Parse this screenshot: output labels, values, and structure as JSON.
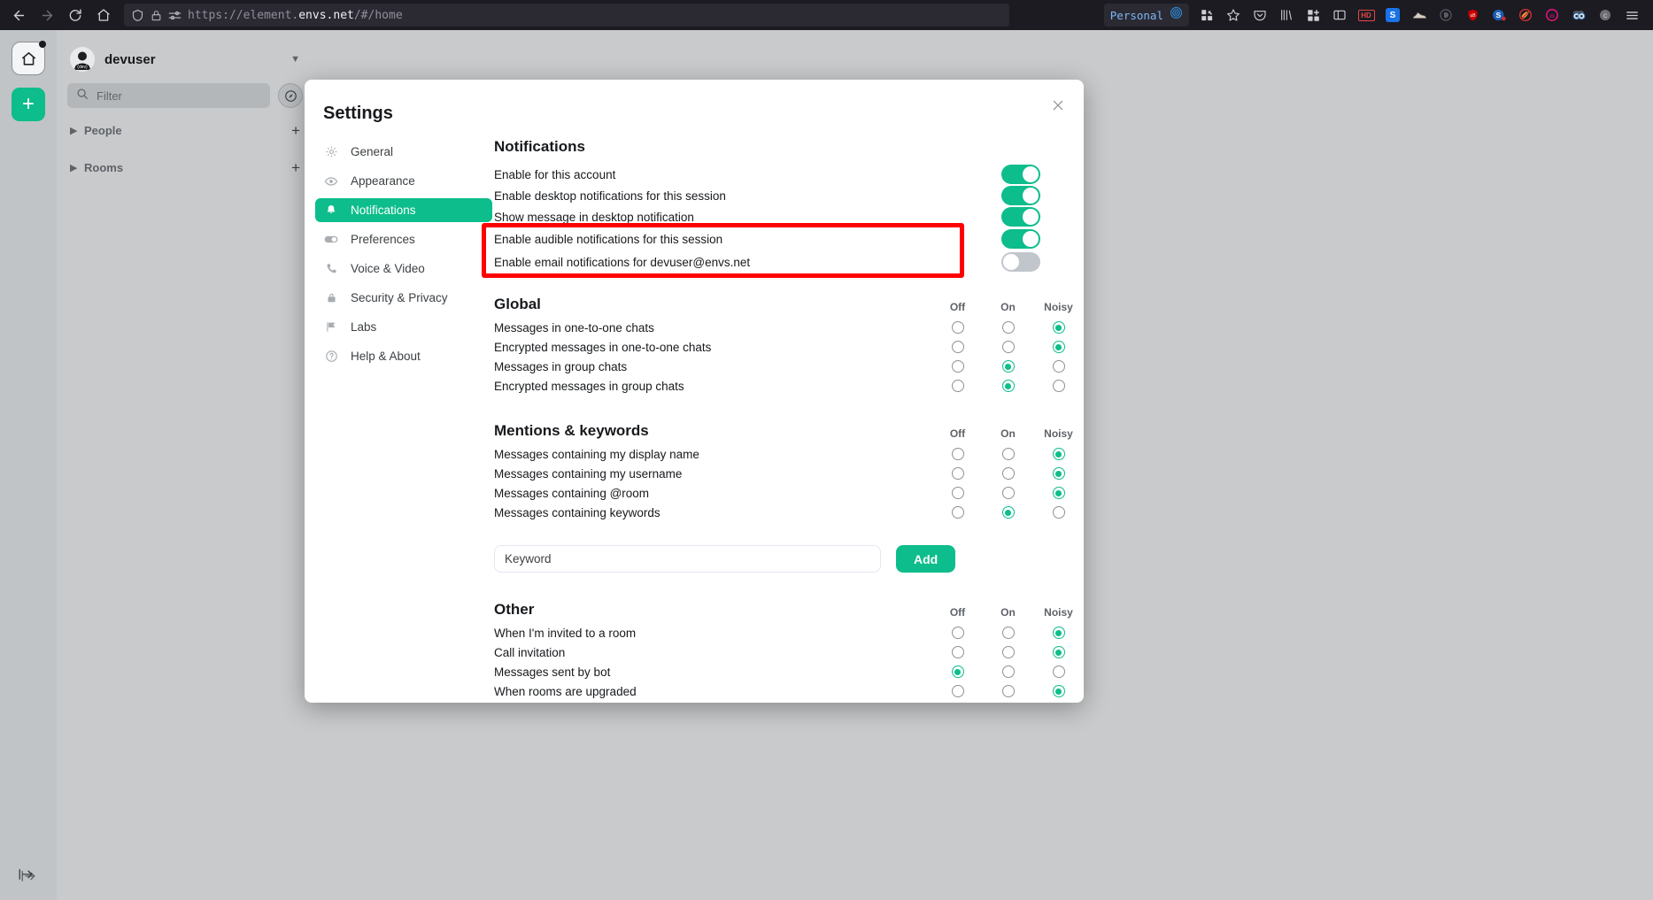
{
  "browser": {
    "url_prefix": "https://element.",
    "url_domain": "envs.net",
    "url_suffix": "/#/home",
    "profile_label": "Personal",
    "nav": {
      "back": "back-arrow",
      "forward": "forward-arrow",
      "reload": "reload",
      "home": "home"
    },
    "extensions": [
      "hd-badge",
      "s-blue-badge",
      "shoe",
      "d-badge",
      "ub-shield",
      "s-red-badge",
      "no-ads",
      "m-badge",
      "eyes",
      "c-badge"
    ]
  },
  "app": {
    "space_home_label": "home-space",
    "add_label": "+",
    "user_name": "devuser",
    "filter_placeholder": "Filter",
    "sections": [
      {
        "label": "People"
      },
      {
        "label": "Rooms"
      }
    ]
  },
  "dialog": {
    "title": "Settings",
    "close_label": "×",
    "nav_items": [
      {
        "label": "General",
        "icon": "gear-icon",
        "active": false
      },
      {
        "label": "Appearance",
        "icon": "eye-icon",
        "active": false
      },
      {
        "label": "Notifications",
        "icon": "bell-icon",
        "active": true
      },
      {
        "label": "Preferences",
        "icon": "toggle-icon",
        "active": false
      },
      {
        "label": "Voice & Video",
        "icon": "phone-icon",
        "active": false
      },
      {
        "label": "Security & Privacy",
        "icon": "lock-icon",
        "active": false
      },
      {
        "label": "Labs",
        "icon": "flag-icon",
        "active": false
      },
      {
        "label": "Help & About",
        "icon": "question-icon",
        "active": false
      }
    ],
    "notifications": {
      "heading": "Notifications",
      "toggles": [
        {
          "label": "Enable for this account",
          "state": "on"
        },
        {
          "label": "Enable desktop notifications for this session",
          "state": "on"
        },
        {
          "label": "Show message in desktop notification",
          "state": "on"
        },
        {
          "label": "Enable audible notifications for this session",
          "state": "on"
        },
        {
          "label": "Enable email notifications for devuser@envs.net",
          "state": "off"
        }
      ],
      "columns": [
        "Off",
        "On",
        "Noisy"
      ],
      "global": {
        "title": "Global",
        "rows": [
          {
            "label": "Messages in one-to-one chats",
            "value": "Noisy"
          },
          {
            "label": "Encrypted messages in one-to-one chats",
            "value": "Noisy"
          },
          {
            "label": "Messages in group chats",
            "value": "On"
          },
          {
            "label": "Encrypted messages in group chats",
            "value": "On"
          }
        ]
      },
      "mentions": {
        "title": "Mentions & keywords",
        "rows": [
          {
            "label": "Messages containing my display name",
            "value": "Noisy"
          },
          {
            "label": "Messages containing my username",
            "value": "Noisy"
          },
          {
            "label": "Messages containing @room",
            "value": "Noisy"
          },
          {
            "label": "Messages containing keywords",
            "value": "On"
          }
        ]
      },
      "keyword": {
        "placeholder": "Keyword",
        "add_label": "Add"
      },
      "other": {
        "title": "Other",
        "rows": [
          {
            "label": "When I'm invited to a room",
            "value": "Noisy"
          },
          {
            "label": "Call invitation",
            "value": "Noisy"
          },
          {
            "label": "Messages sent by bot",
            "value": "Off"
          },
          {
            "label": "When rooms are upgraded",
            "value": "Noisy"
          }
        ]
      }
    }
  },
  "colors": {
    "accent": "#0dbd8b",
    "highlight_box": "#fe0000",
    "chrome_bg": "#1c1b22",
    "toggle_off": "#c1c6cd"
  }
}
